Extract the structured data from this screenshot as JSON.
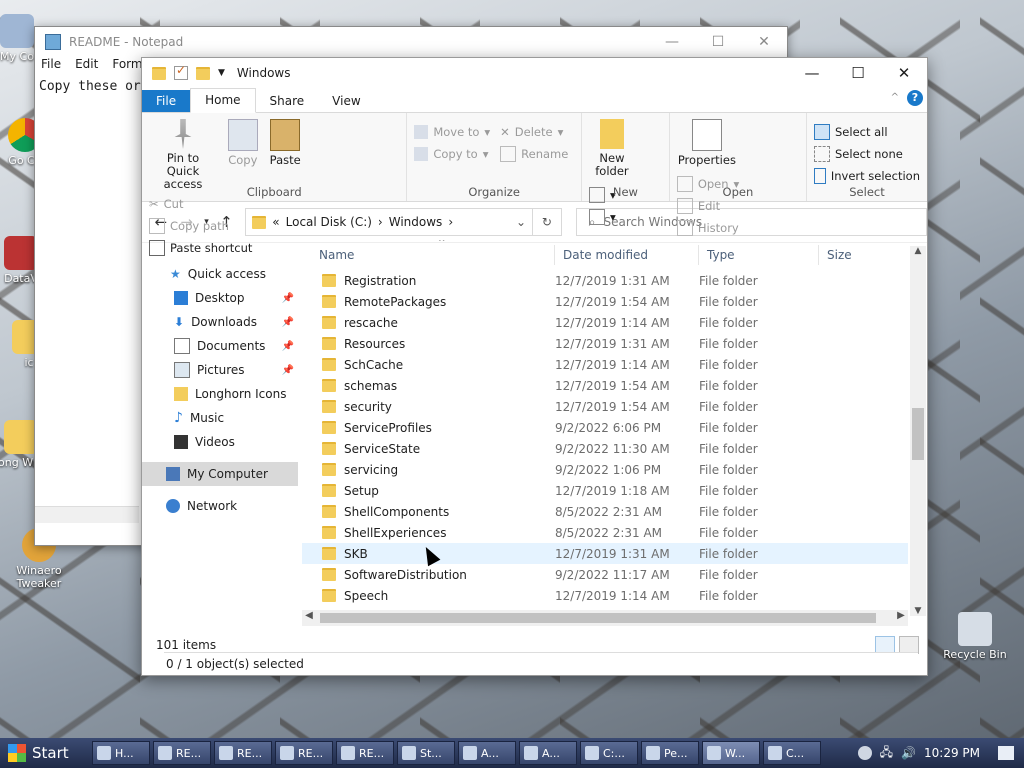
{
  "desktop": {
    "icons": [
      {
        "label": "My Co"
      },
      {
        "label": "Go Ch"
      },
      {
        "label": "DataV"
      },
      {
        "label": "ic"
      },
      {
        "label": "Long Wind"
      },
      {
        "label": "Winaero Tweaker"
      },
      {
        "label": "Recycle Bin"
      }
    ]
  },
  "notepad": {
    "title": "README - Notepad",
    "menu": [
      "File",
      "Edit",
      "Forma"
    ],
    "text": "Copy these or"
  },
  "explorer": {
    "title": "Windows",
    "tabs": [
      "File",
      "Home",
      "Share",
      "View"
    ],
    "ribbon": {
      "clipboard": {
        "name": "Clipboard",
        "pin": "Pin to Quick access",
        "copy": "Copy",
        "paste": "Paste",
        "cut": "Cut",
        "copy_path": "Copy path",
        "paste_shortcut": "Paste shortcut"
      },
      "organize": {
        "name": "Organize",
        "move_to": "Move to",
        "copy_to": "Copy to",
        "delete": "Delete",
        "rename": "Rename"
      },
      "new": {
        "name": "New",
        "new_folder": "New folder"
      },
      "open": {
        "name": "Open",
        "properties": "Properties",
        "open": "Open",
        "edit": "Edit",
        "history": "History"
      },
      "select": {
        "name": "Select",
        "select_all": "Select all",
        "select_none": "Select none",
        "invert": "Invert selection"
      }
    },
    "address": {
      "prefix": "«",
      "part1": "Local Disk (C:)",
      "part2": "Windows"
    },
    "search_placeholder": "Search Windows",
    "nav": {
      "quick_access": "Quick access",
      "desktop": "Desktop",
      "downloads": "Downloads",
      "documents": "Documents",
      "pictures": "Pictures",
      "longhorn": "Longhorn Icons",
      "music": "Music",
      "videos": "Videos",
      "my_computer": "My Computer",
      "network": "Network"
    },
    "columns": {
      "name": "Name",
      "date": "Date modified",
      "type": "Type",
      "size": "Size"
    },
    "rows": [
      {
        "name": "Registration",
        "date": "12/7/2019 1:31 AM",
        "type": "File folder"
      },
      {
        "name": "RemotePackages",
        "date": "12/7/2019 1:54 AM",
        "type": "File folder"
      },
      {
        "name": "rescache",
        "date": "12/7/2019 1:14 AM",
        "type": "File folder"
      },
      {
        "name": "Resources",
        "date": "12/7/2019 1:31 AM",
        "type": "File folder"
      },
      {
        "name": "SchCache",
        "date": "12/7/2019 1:14 AM",
        "type": "File folder"
      },
      {
        "name": "schemas",
        "date": "12/7/2019 1:54 AM",
        "type": "File folder"
      },
      {
        "name": "security",
        "date": "12/7/2019 1:54 AM",
        "type": "File folder"
      },
      {
        "name": "ServiceProfiles",
        "date": "9/2/2022 6:06 PM",
        "type": "File folder"
      },
      {
        "name": "ServiceState",
        "date": "9/2/2022 11:30 AM",
        "type": "File folder"
      },
      {
        "name": "servicing",
        "date": "9/2/2022 1:06 PM",
        "type": "File folder"
      },
      {
        "name": "Setup",
        "date": "12/7/2019 1:18 AM",
        "type": "File folder"
      },
      {
        "name": "ShellComponents",
        "date": "8/5/2022 2:31 AM",
        "type": "File folder"
      },
      {
        "name": "ShellExperiences",
        "date": "8/5/2022 2:31 AM",
        "type": "File folder"
      },
      {
        "name": "SKB",
        "date": "12/7/2019 1:31 AM",
        "type": "File folder"
      },
      {
        "name": "SoftwareDistribution",
        "date": "9/2/2022 11:17 AM",
        "type": "File folder"
      },
      {
        "name": "Speech",
        "date": "12/7/2019 1:14 AM",
        "type": "File folder"
      }
    ],
    "item_count": "101 items",
    "selection": "0 / 1 object(s) selected"
  },
  "taskbar": {
    "start": "Start",
    "buttons": [
      "H...",
      "RE...",
      "RE...",
      "RE...",
      "RE...",
      "St...",
      "A...",
      "A...",
      "C:...",
      "Pe...",
      "W...",
      "C..."
    ],
    "active_index": 10,
    "clock": "10:29 PM"
  },
  "colors": {
    "accent": "#1979ca",
    "folder": "#f3cd5c",
    "hover_row": "#e5f3ff"
  }
}
